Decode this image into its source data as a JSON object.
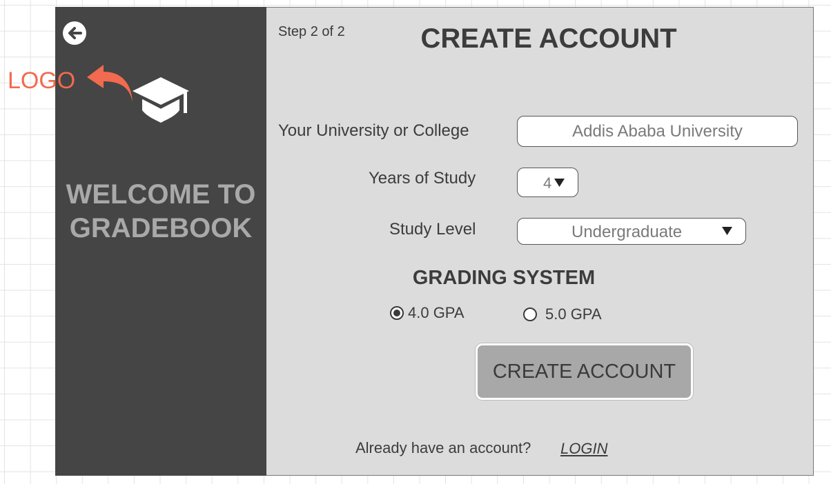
{
  "annotation": {
    "logo_label": "LOGO"
  },
  "sidebar": {
    "welcome_line1": "WELCOME TO",
    "welcome_line2": "GRADEBOOK",
    "back_icon": "arrow-left-circle-icon",
    "logo_icon": "graduation-cap-icon"
  },
  "header": {
    "step": "Step 2 of 2",
    "title": "CREATE ACCOUNT"
  },
  "form": {
    "university": {
      "label": "Your University or College",
      "value": "Addis Ababa University"
    },
    "years": {
      "label": "Years of Study",
      "value": "4"
    },
    "level": {
      "label": "Study Level",
      "value": "Undergraduate"
    }
  },
  "grading": {
    "title": "GRADING SYSTEM",
    "options": [
      {
        "label": "4.0 GPA",
        "selected": true
      },
      {
        "label": "5.0 GPA",
        "selected": false
      }
    ]
  },
  "actions": {
    "create_label": "CREATE ACCOUNT"
  },
  "footer": {
    "prompt": "Already have an account?",
    "login_label": "LOGIN"
  },
  "colors": {
    "sidebar_bg": "#454545",
    "panel_bg": "#dcdcdc",
    "annotation": "#f26a4f",
    "button_bg": "#a8a8a8"
  }
}
